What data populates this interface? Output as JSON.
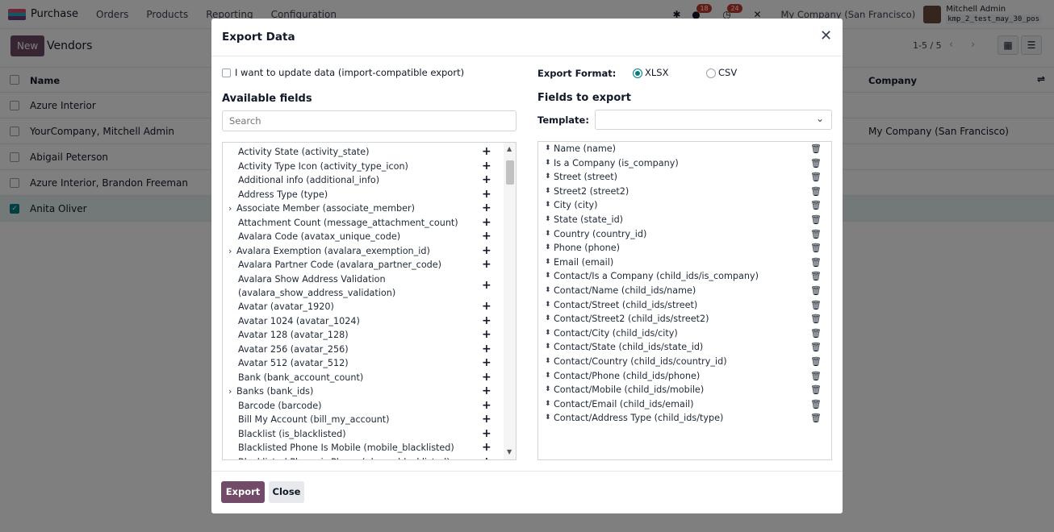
{
  "app": {
    "name": "Purchase",
    "menu": [
      "Orders",
      "Products",
      "Reporting",
      "Configuration"
    ],
    "chat_badge": "18",
    "activity_badge": "24",
    "company": "My Company (San Francisco)",
    "user_name": "Mitchell Admin",
    "user_db": "kmp_2_test_may_30_pos"
  },
  "control_panel": {
    "new_label": "New",
    "title": "Vendors",
    "pager": "1-5 / 5"
  },
  "list": {
    "columns": {
      "name": "Name",
      "company": "Company"
    },
    "rows": [
      {
        "name": "Azure Interior",
        "company": "",
        "checked": false
      },
      {
        "name": "YourCompany, Mitchell Admin",
        "company": "My Company (San Francisco)",
        "checked": false
      },
      {
        "name": "Abigail Peterson",
        "company": "",
        "checked": false
      },
      {
        "name": "Azure Interior, Brandon Freeman",
        "company": "",
        "checked": false
      },
      {
        "name": "Anita Oliver",
        "company": "",
        "checked": true
      }
    ]
  },
  "modal": {
    "title": "Export Data",
    "import_compat_label": "I want to update data (import-compatible export)",
    "available_title": "Available fields",
    "search_placeholder": "Search",
    "export_format_label": "Export Format:",
    "format_options": [
      "XLSX",
      "CSV"
    ],
    "selected_format": "XLSX",
    "fields_to_export_title": "Fields to export",
    "template_label": "Template:",
    "template_value": "",
    "available_fields": [
      {
        "label": "Activity State (activity_state)",
        "expandable": false
      },
      {
        "label": "Activity Type Icon (activity_type_icon)",
        "expandable": false
      },
      {
        "label": "Additional info (additional_info)",
        "expandable": false
      },
      {
        "label": "Address Type (type)",
        "expandable": false
      },
      {
        "label": "Associate Member (associate_member)",
        "expandable": true
      },
      {
        "label": "Attachment Count (message_attachment_count)",
        "expandable": false
      },
      {
        "label": "Avalara Code (avatax_unique_code)",
        "expandable": false
      },
      {
        "label": "Avalara Exemption (avalara_exemption_id)",
        "expandable": true
      },
      {
        "label": "Avalara Partner Code (avalara_partner_code)",
        "expandable": false
      },
      {
        "label": "Avalara Show Address Validation",
        "label2": "(avalara_show_address_validation)",
        "expandable": false
      },
      {
        "label": "Avatar (avatar_1920)",
        "expandable": false
      },
      {
        "label": "Avatar 1024 (avatar_1024)",
        "expandable": false
      },
      {
        "label": "Avatar 128 (avatar_128)",
        "expandable": false
      },
      {
        "label": "Avatar 256 (avatar_256)",
        "expandable": false
      },
      {
        "label": "Avatar 512 (avatar_512)",
        "expandable": false
      },
      {
        "label": "Bank (bank_account_count)",
        "expandable": false
      },
      {
        "label": "Banks (bank_ids)",
        "expandable": true
      },
      {
        "label": "Barcode (barcode)",
        "expandable": false
      },
      {
        "label": "Bill My Account (bill_my_account)",
        "expandable": false
      },
      {
        "label": "Blacklist (is_blacklisted)",
        "expandable": false
      },
      {
        "label": "Blacklisted Phone Is Mobile (mobile_blacklisted)",
        "expandable": false
      },
      {
        "label": "Blacklisted Phone is Phone (phone_blacklisted)",
        "expandable": false
      }
    ],
    "export_fields": [
      "Name (name)",
      "Is a Company (is_company)",
      "Street (street)",
      "Street2 (street2)",
      "City (city)",
      "State (state_id)",
      "Country (country_id)",
      "Phone (phone)",
      "Email (email)",
      "Contact/Is a Company (child_ids/is_company)",
      "Contact/Name (child_ids/name)",
      "Contact/Street (child_ids/street)",
      "Contact/Street2 (child_ids/street2)",
      "Contact/City (child_ids/city)",
      "Contact/State (child_ids/state_id)",
      "Contact/Country (child_ids/country_id)",
      "Contact/Phone (child_ids/phone)",
      "Contact/Mobile (child_ids/mobile)",
      "Contact/Email (child_ids/email)",
      "Contact/Address Type (child_ids/type)"
    ],
    "export_button": "Export",
    "close_button": "Close"
  }
}
